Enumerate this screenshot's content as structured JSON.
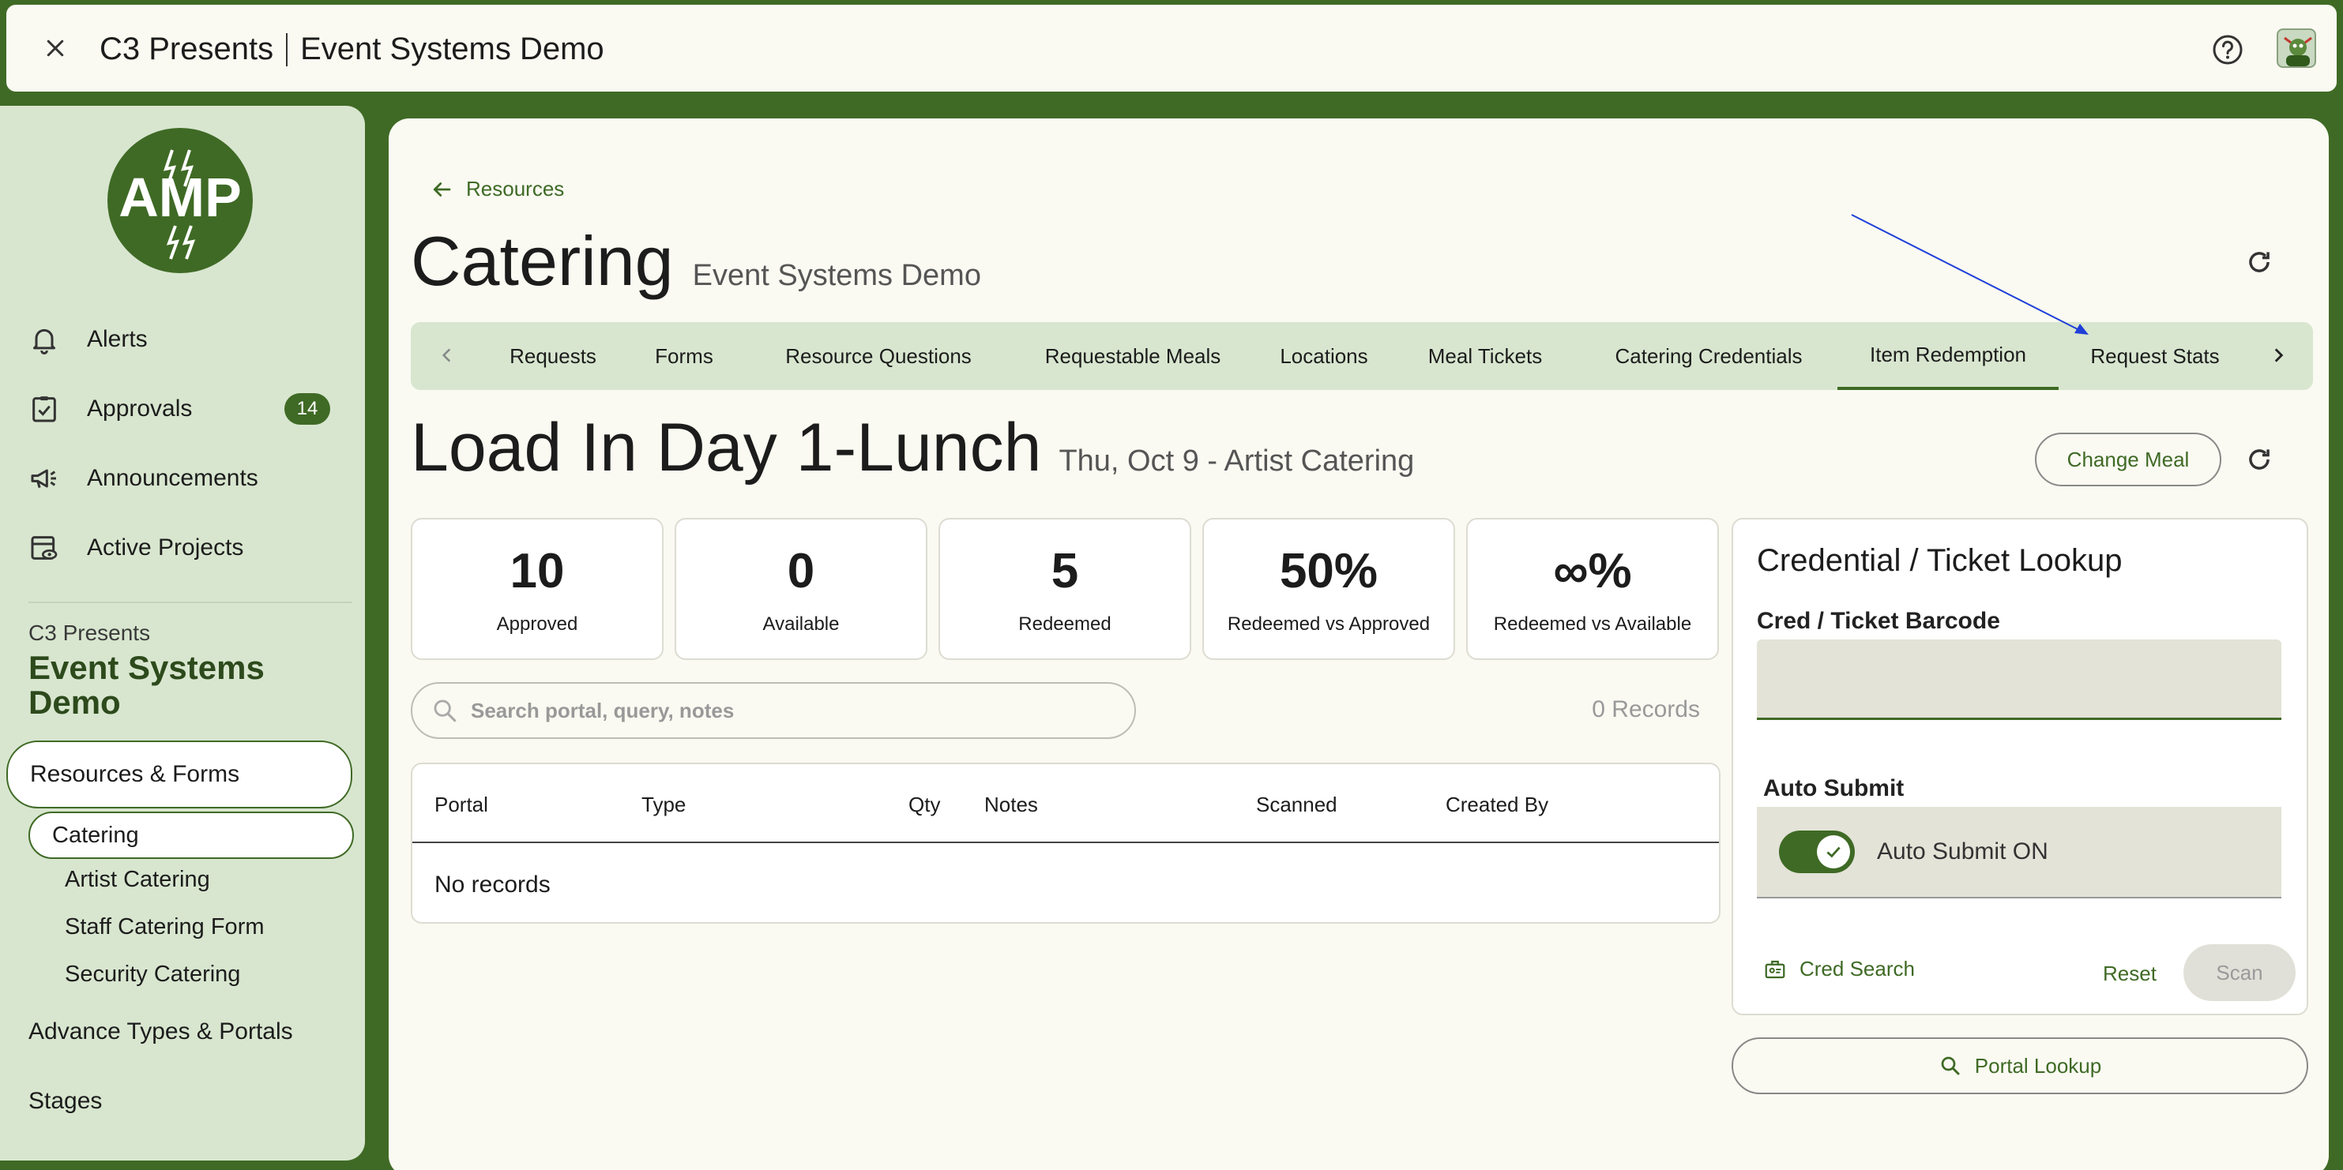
{
  "window": {
    "org": "C3 Presents",
    "project": "Event Systems Demo"
  },
  "sidebar": {
    "nav": [
      {
        "label": "Alerts",
        "icon": "bell-icon"
      },
      {
        "label": "Approvals",
        "icon": "clipboard-check-icon",
        "badge": "14"
      },
      {
        "label": "Announcements",
        "icon": "megaphone-icon"
      },
      {
        "label": "Active Projects",
        "icon": "calendar-eye-icon"
      }
    ],
    "org": "C3 Presents",
    "project": "Event Systems Demo",
    "section_active": "Resources & Forms",
    "catering": "Catering",
    "catering_items": [
      "Artist Catering",
      "Staff Catering Form",
      "Security Catering"
    ],
    "advance": "Advance Types & Portals",
    "stages": "Stages"
  },
  "header": {
    "back_label": "Resources",
    "title": "Catering",
    "subtitle": "Event Systems Demo"
  },
  "tabs": {
    "items": [
      "Requests",
      "Forms",
      "Resource Questions",
      "Requestable Meals",
      "Locations",
      "Meal Tickets",
      "Catering Credentials",
      "Item Redemption",
      "Request Stats"
    ],
    "active": "Item Redemption"
  },
  "meal": {
    "title": "Load In Day 1-Lunch",
    "subtitle": "Thu, Oct 9 - Artist Catering",
    "change_label": "Change Meal"
  },
  "stats": [
    {
      "value": "10",
      "label": "Approved"
    },
    {
      "value": "0",
      "label": "Available"
    },
    {
      "value": "5",
      "label": "Redeemed"
    },
    {
      "value": "50%",
      "label": "Redeemed vs Approved"
    },
    {
      "value": "∞%",
      "label": "Redeemed vs Available"
    }
  ],
  "search": {
    "placeholder": "Search portal, query, notes",
    "records": "0 Records"
  },
  "table": {
    "columns": [
      "Portal",
      "Type",
      "Qty",
      "Notes",
      "Scanned",
      "Created By"
    ],
    "empty": "No records"
  },
  "lookup": {
    "title": "Credential / Ticket Lookup",
    "barcode_label": "Cred / Ticket Barcode",
    "barcode_value": "",
    "auto_label": "Auto Submit",
    "auto_toggle": "Auto Submit ON",
    "cred_search": "Cred Search",
    "reset": "Reset",
    "scan": "Scan"
  },
  "portal_lookup": "Portal Lookup",
  "colors": {
    "brand": "#3f6a25",
    "sidebar": "#d8e6cf",
    "panel": "#fafaf2",
    "annotation": "#1f3fd8"
  }
}
